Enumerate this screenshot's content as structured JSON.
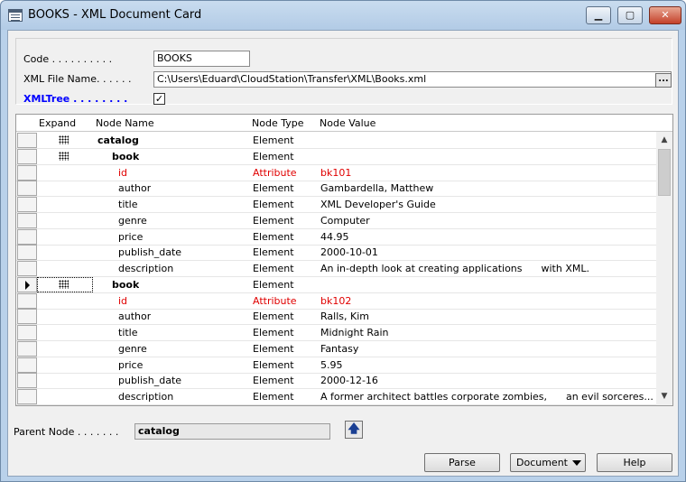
{
  "window": {
    "title": "BOOKS - XML Document Card",
    "min_glyph": "▁",
    "max_glyph": "▢",
    "close_glyph": "✕"
  },
  "fields": {
    "code_label": "Code . . . . . . . . . .",
    "code_value": "BOOKS",
    "xml_file_label": "XML File Name. . . . . .",
    "xml_file_value": "C:\\Users\\Eduard\\CloudStation\\Transfer\\XML\\Books.xml",
    "xml_file_lookup": "...",
    "xmltree_label": "XMLTree . . . . . . . .",
    "xmltree_checked": "✓"
  },
  "grid": {
    "columns": {
      "expand": "Expand",
      "node_name": "Node Name",
      "node_type": "Node Type",
      "node_value": "Node Value"
    },
    "rows": [
      {
        "name": "catalog",
        "type": "Element",
        "value": ""
      },
      {
        "name": "book",
        "type": "Element",
        "value": ""
      },
      {
        "name": "id",
        "type": "Attribute",
        "value": "bk101"
      },
      {
        "name": "author",
        "type": "Element",
        "value": "Gambardella, Matthew"
      },
      {
        "name": "title",
        "type": "Element",
        "value": "XML Developer's Guide"
      },
      {
        "name": "genre",
        "type": "Element",
        "value": "Computer"
      },
      {
        "name": "price",
        "type": "Element",
        "value": "44.95"
      },
      {
        "name": "publish_date",
        "type": "Element",
        "value": "2000-10-01"
      },
      {
        "name": "description",
        "type": "Element",
        "value": "An in-depth look at creating applications      with XML."
      },
      {
        "name": "book",
        "type": "Element",
        "value": ""
      },
      {
        "name": "id",
        "type": "Attribute",
        "value": "bk102"
      },
      {
        "name": "author",
        "type": "Element",
        "value": "Ralls, Kim"
      },
      {
        "name": "title",
        "type": "Element",
        "value": "Midnight Rain"
      },
      {
        "name": "genre",
        "type": "Element",
        "value": "Fantasy"
      },
      {
        "name": "price",
        "type": "Element",
        "value": "5.95"
      },
      {
        "name": "publish_date",
        "type": "Element",
        "value": "2000-12-16"
      },
      {
        "name": "description",
        "type": "Element",
        "value": "A former architect battles corporate zombies,      an evil sorceres..."
      }
    ],
    "scroll_up": "▲",
    "scroll_down": "▼"
  },
  "parent": {
    "label": "Parent Node . . . . . . .",
    "value": "catalog",
    "up_glyph": "🡅"
  },
  "buttons": {
    "parse": "Parse",
    "document": "Document",
    "help": "Help"
  },
  "colors": {
    "attribute": "#e00000",
    "label_blue": "#0000ff"
  }
}
